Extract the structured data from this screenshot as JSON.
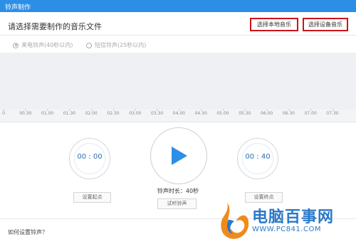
{
  "window": {
    "title": "铃声制作"
  },
  "header": {
    "prompt": "请选择需要制作的音乐文件"
  },
  "actions": {
    "select_local": "选择本地音乐",
    "select_device": "选择设备音乐"
  },
  "ringtone_types": [
    {
      "label": "来电铃声(40秒以内)",
      "checked": true
    },
    {
      "label": "短信铃声(25秒以内)",
      "checked": false
    }
  ],
  "timeline": {
    "ticks": [
      "0",
      "00.30",
      "01.00",
      "01.30",
      "02.00",
      "02.30",
      "03.00",
      "03.30",
      "04.00",
      "04.30",
      "05.00",
      "05.30",
      "06.00",
      "06.30",
      "07.00",
      "07.30"
    ]
  },
  "controls": {
    "start_time": "00 : 00",
    "end_time": "00 : 40",
    "set_start": "设置起点",
    "set_end": "设置终点",
    "duration": "铃声时长：40秒",
    "audition": "试听铃声"
  },
  "footer": {
    "help": "如何设置铃声？"
  },
  "watermark": {
    "name": "电脑百事网",
    "url": "WWW.PC841.COM"
  },
  "colors": {
    "accent": "#2d8ee6",
    "highlight": "#c8151b",
    "play": "#2d8ee6"
  }
}
